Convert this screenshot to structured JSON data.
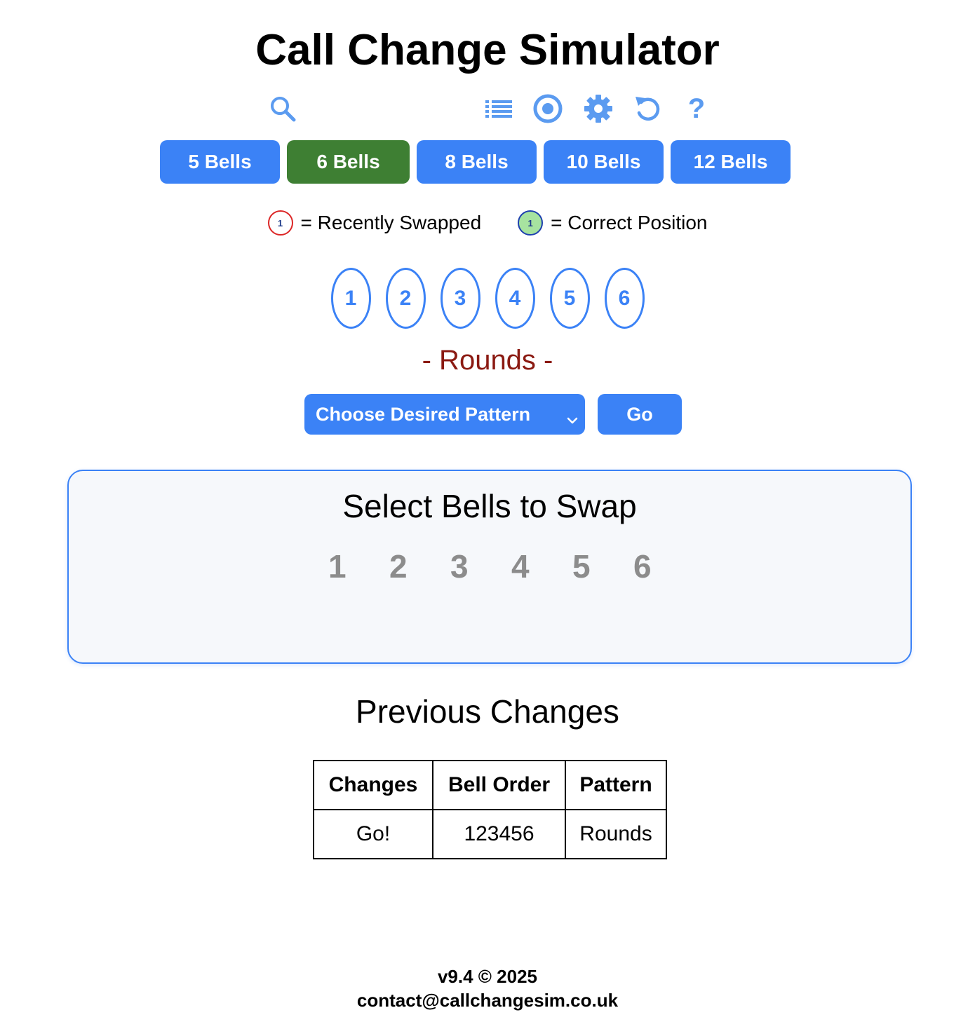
{
  "header": {
    "title": "Call Change Simulator"
  },
  "toolbar": {
    "icons": [
      "search-icon",
      "list-icon",
      "target-icon",
      "gear-icon",
      "undo-icon",
      "help-icon"
    ],
    "icon_color": "#5b9bf0"
  },
  "bell_count_buttons": [
    {
      "label": "5 Bells",
      "active": false
    },
    {
      "label": "6 Bells",
      "active": true
    },
    {
      "label": "8 Bells",
      "active": false
    },
    {
      "label": "10 Bells",
      "active": false
    },
    {
      "label": "12 Bells",
      "active": false
    }
  ],
  "legend": {
    "swapped": {
      "sample": "1",
      "label": "= Recently Swapped",
      "color": "#dc2626"
    },
    "correct": {
      "sample": "1",
      "label": "= Correct Position",
      "color": "#a7e3a0"
    }
  },
  "bells": [
    "1",
    "2",
    "3",
    "4",
    "5",
    "6"
  ],
  "current_pattern": "- Rounds -",
  "pattern_select": {
    "selected": "Choose Desired Pattern"
  },
  "go_button": "Go",
  "swap_panel": {
    "title": "Select Bells to Swap",
    "numbers": [
      "1",
      "2",
      "3",
      "4",
      "5",
      "6"
    ]
  },
  "previous_changes": {
    "title": "Previous Changes",
    "columns": [
      "Changes",
      "Bell Order",
      "Pattern"
    ],
    "rows": [
      [
        "Go!",
        "123456",
        "Rounds"
      ]
    ]
  },
  "footer": {
    "version": "v9.4 © 2025",
    "contact": "contact@callchangesim.co.uk"
  },
  "colors": {
    "primary": "#3b82f6",
    "active": "#3e7f33",
    "pattern_text": "#8b1a12"
  }
}
